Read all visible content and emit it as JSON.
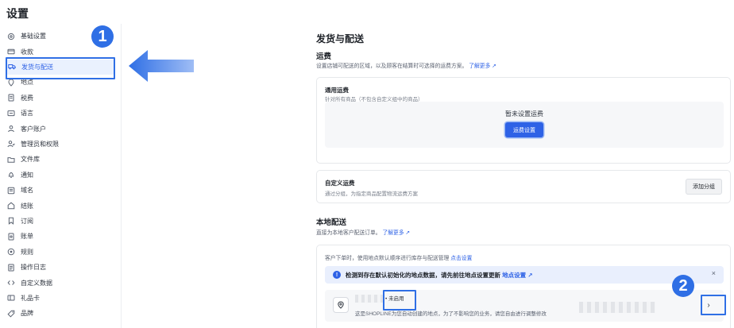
{
  "page_title": "设置",
  "sidebar": {
    "items": [
      {
        "label": "基础设置",
        "icon": "settings-icon"
      },
      {
        "label": "收款",
        "icon": "wallet-icon"
      },
      {
        "label": "发货与配送",
        "icon": "truck-icon",
        "active": true
      },
      {
        "label": "地点",
        "icon": "location-icon"
      },
      {
        "label": "税费",
        "icon": "receipt-icon"
      },
      {
        "label": "语言",
        "icon": "language-icon"
      },
      {
        "label": "客户账户",
        "icon": "user-icon"
      },
      {
        "label": "管理员和权限",
        "icon": "users-icon"
      },
      {
        "label": "文件库",
        "icon": "folder-icon"
      },
      {
        "label": "通知",
        "icon": "bell-icon"
      },
      {
        "label": "域名",
        "icon": "globe-icon"
      },
      {
        "label": "结账",
        "icon": "checkout-icon"
      },
      {
        "label": "订阅",
        "icon": "bookmark-icon"
      },
      {
        "label": "账单",
        "icon": "bill-icon"
      },
      {
        "label": "规则",
        "icon": "rule-icon"
      },
      {
        "label": "操作日志",
        "icon": "log-icon"
      },
      {
        "label": "自定义数据",
        "icon": "code-icon"
      },
      {
        "label": "礼品卡",
        "icon": "gift-card-icon"
      },
      {
        "label": "品牌",
        "icon": "brand-icon"
      }
    ]
  },
  "main": {
    "title": "发货与配送",
    "shipping": {
      "heading": "运费",
      "desc": "设置店铺可配送的区域，以及顾客在结算时可选择的运费方案。",
      "learn_more": "了解更多",
      "general_card": {
        "title": "通用运费",
        "subtitle": "针对所有商品（不包含自定义组中的商品）",
        "empty_text": "暂未设置运费",
        "button": "运费设置"
      },
      "custom_card": {
        "title": "自定义运费",
        "subtitle": "通过分组，为指定商品配置物流运费方案",
        "button": "添加分组"
      }
    },
    "local_delivery": {
      "heading": "本地配送",
      "desc": "直接为本地客户配送订单。",
      "learn_more": "了解更多",
      "card": {
        "intro": "客户下单时，使用地点默认顺序进行库存与配送管理",
        "intro_link": "点击设置",
        "alert_text": "检测到存在默认初始化的地点数据，请先前往地点设置更新",
        "alert_link": "地点设置",
        "alert_close": "×",
        "location_status": "• 未启用",
        "location_desc": "这是SHOPLINE为您自动创建的地点，为了不影响您的业务，请您自由进行调整修改",
        "chevron": "›"
      }
    }
  },
  "annotations": {
    "step1": "1",
    "step2": "2",
    "color": "#2f6fe5"
  }
}
